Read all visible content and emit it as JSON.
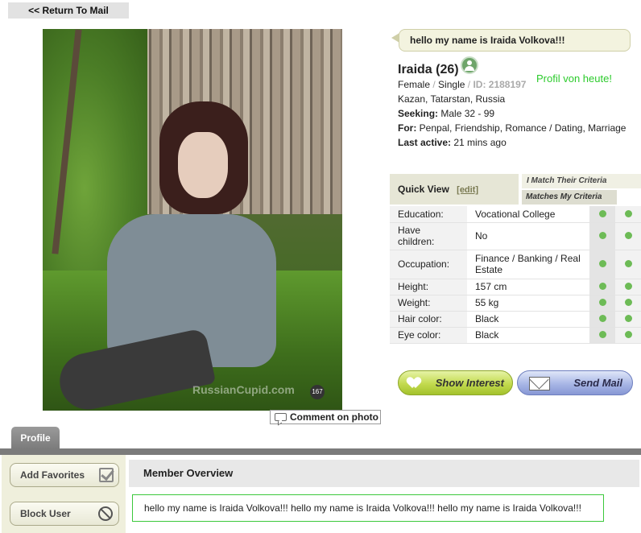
{
  "nav": {
    "return_label": "<< Return To Mail"
  },
  "photo": {
    "watermark": "RussianCupid.com",
    "count": "167",
    "comment_label": "Comment on photo"
  },
  "profile": {
    "headline": "hello my name is Iraida Volkova!!!",
    "name_age": "Iraida (26)",
    "gender": "Female",
    "status": "Single",
    "id_text": "ID: 2188197",
    "location": "Kazan, Tatarstan, Russia",
    "seeking_label": "Seeking:",
    "seeking_value": "Male 32 - 99",
    "for_label": "For:",
    "for_value": "Penpal, Friendship, Romance / Dating, Marriage",
    "last_active_label": "Last active:",
    "last_active_value": "21 mins ago",
    "annotation": "Profil von heute!"
  },
  "quick_view": {
    "title": "Quick View",
    "edit_label": "[edit]",
    "criteria_1": "I Match Their Criteria",
    "criteria_2": "Matches My Criteria",
    "rows": [
      {
        "label": "Education:",
        "value": "Vocational College"
      },
      {
        "label": "Have children:",
        "value": "No"
      },
      {
        "label": "Occupation:",
        "value": "Finance / Banking / Real Estate"
      },
      {
        "label": "Height:",
        "value": "157 cm"
      },
      {
        "label": "Weight:",
        "value": "55 kg"
      },
      {
        "label": "Hair color:",
        "value": "Black"
      },
      {
        "label": "Eye color:",
        "value": "Black"
      }
    ]
  },
  "actions": {
    "interest_label": "Show Interest",
    "mail_label": "Send Mail"
  },
  "tabs": {
    "profile": "Profile"
  },
  "sidebar": {
    "favorites_label": "Add Favorites",
    "block_label": "Block User"
  },
  "overview": {
    "title": "Member Overview",
    "text": "hello my name is Iraida Volkova!!! hello my name is Iraida Volkova!!! hello my name is Iraida Volkova!!!"
  }
}
